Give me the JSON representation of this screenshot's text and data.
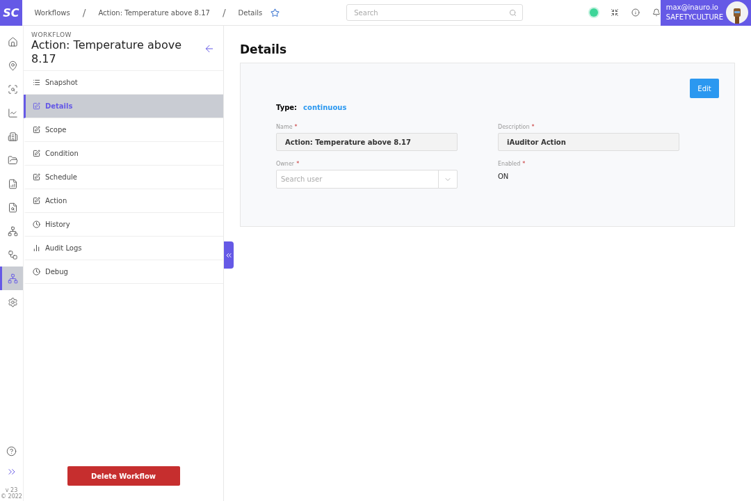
{
  "logo": "SC",
  "breadcrumbs": [
    {
      "label": "Workflows"
    },
    {
      "separator": "/",
      "label": "Action: Temperature above 8.17"
    },
    {
      "separator": "/",
      "label": "Details"
    }
  ],
  "search": {
    "placeholder": "Search"
  },
  "user": {
    "email": "max@inauro.io",
    "org": "SAFETYCULTURE"
  },
  "rail": [
    {
      "selected": false
    },
    {
      "selected": false
    },
    {
      "selected": false
    },
    {
      "selected": false
    },
    {
      "selected": false
    },
    {
      "selected": false
    },
    {
      "selected": false
    },
    {
      "selected": false
    },
    {
      "selected": false
    },
    {
      "selected": false
    },
    {
      "selected": true
    },
    {
      "selected": false
    }
  ],
  "version": "v 23",
  "copyright": "© 2022",
  "sidebar": {
    "caption": "WORKFLOW",
    "title": "Action: Temperature above 8.17",
    "items": [
      {
        "label": "Snapshot",
        "selected": false
      },
      {
        "label": "Details",
        "selected": true
      },
      {
        "label": "Scope",
        "selected": false
      },
      {
        "label": "Condition",
        "selected": false
      },
      {
        "label": "Schedule",
        "selected": false
      },
      {
        "label": "Action",
        "selected": false
      },
      {
        "label": "History",
        "selected": false
      },
      {
        "label": "Audit Logs",
        "selected": false
      },
      {
        "label": "Debug",
        "selected": false
      }
    ],
    "delete_button": "Delete Workflow"
  },
  "main": {
    "heading": "Details",
    "edit_button": "Edit",
    "type_label": "Type:",
    "type_value": "continuous",
    "fields": [
      {
        "label": "Name",
        "required_mark": "*",
        "kind": "text",
        "value": "Action: Temperature above 8.17"
      },
      {
        "label": "Description",
        "required_mark": "*",
        "kind": "text",
        "value": "iAuditor Action"
      },
      {
        "label": "Owner",
        "required_mark": "*",
        "kind": "select",
        "placeholder": "Search user"
      },
      {
        "label": "Enabled",
        "required_mark": "*",
        "kind": "static",
        "value": "ON"
      }
    ]
  }
}
